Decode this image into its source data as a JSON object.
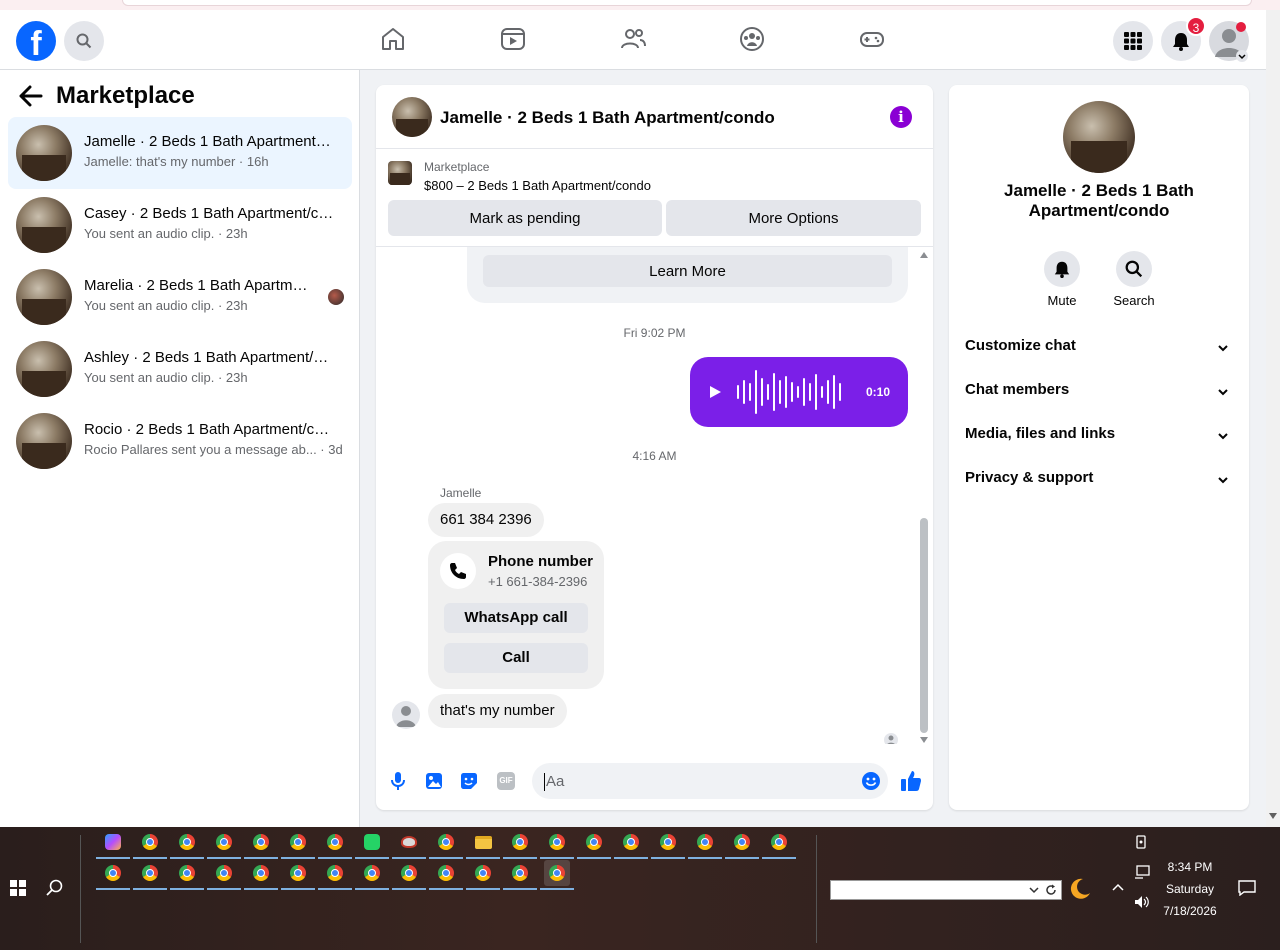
{
  "header": {
    "logo_letter": "f",
    "notifications_count": "3"
  },
  "sidebar": {
    "title": "Marketplace",
    "conversations": [
      {
        "name": "Jamelle · 2 Beds 1 Bath Apartment/condo",
        "sub": "Jamelle: that's my number · 16h"
      },
      {
        "name": "Casey · 2 Beds 1 Bath Apartment/condo",
        "sub": "You sent an audio clip. · 23h"
      },
      {
        "name": "Marelia · 2 Beds 1 Bath Apartment/condo",
        "sub": "You sent an audio clip. · 23h"
      },
      {
        "name": "Ashley · 2 Beds 1 Bath Apartment/condo",
        "sub": "You sent an audio clip. · 23h"
      },
      {
        "name": "Rocio · 2 Beds 1 Bath Apartment/condo",
        "sub": "Rocio Pallares sent you a message ab... · 3d"
      }
    ]
  },
  "chat": {
    "title": "Jamelle · 2 Beds 1 Bath Apartment/condo",
    "info_glyph": "i",
    "listing_label": "Marketplace",
    "listing_price": "$800 – 2 Beds 1 Bath Apartment/condo",
    "mark_pending": "Mark as pending",
    "more_options": "More Options",
    "learn_more": "Learn More",
    "timestamp_1": "Fri 9:02 PM",
    "audio_duration": "0:10",
    "timestamp_2": "4:16 AM",
    "sender_name": "Jamelle",
    "msg_number": "661 384 2396",
    "phone_card_title": "Phone number",
    "phone_card_number": "+1 661-384-2396",
    "whatsapp_call": "WhatsApp call",
    "call": "Call",
    "msg_last": "that's my number",
    "composer_placeholder": "Aa",
    "gif_label": "GIF"
  },
  "details": {
    "title": "Jamelle · 2 Beds 1 Bath Apartment/condo",
    "mute": "Mute",
    "search": "Search",
    "rows": [
      "Customize chat",
      "Chat members",
      "Media, files and links",
      "Privacy & support"
    ]
  },
  "taskbar": {
    "time": "8:34 PM",
    "day": "Saturday",
    "date": "7/18/2026"
  },
  "colors": {
    "brand_blue": "#0866ff",
    "messenger_purple": "#7b1fe8",
    "notification_red": "#e41e3f"
  }
}
